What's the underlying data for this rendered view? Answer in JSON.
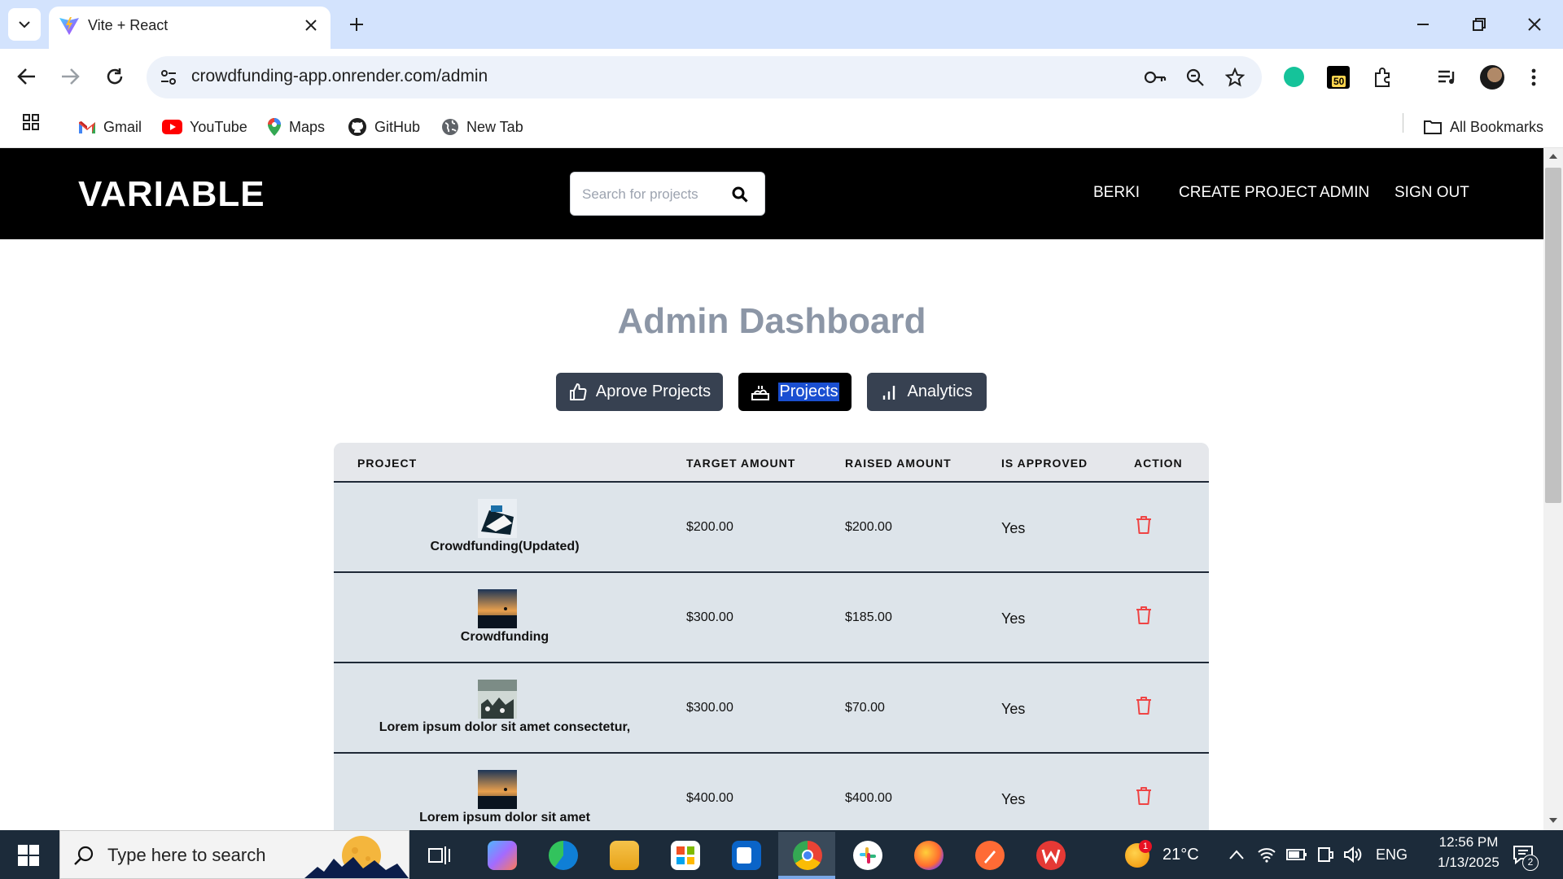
{
  "browser": {
    "tab_title": "Vite + React",
    "url": "crowdfunding-app.onrender.com/admin",
    "extension_badge": "50",
    "bookmarks": [
      "Gmail",
      "YouTube",
      "Maps",
      "GitHub",
      "New Tab"
    ],
    "all_bookmarks": "All Bookmarks"
  },
  "app": {
    "brand": "VARIABLE",
    "search_placeholder": "Search for projects",
    "nav": [
      "BERKI",
      "CREATE PROJECT",
      "ADMIN",
      "SIGN OUT"
    ]
  },
  "dashboard": {
    "title": "Admin Dashboard",
    "tabs": [
      "Aprove Projects",
      "Projects",
      "Analytics"
    ],
    "active_tab": "Projects"
  },
  "table": {
    "headers": [
      "PROJECT",
      "TARGET AMOUNT",
      "RAISED AMOUNT",
      "IS APPROVED",
      "ACTION"
    ],
    "rows": [
      {
        "name": "Crowdfunding(Updated)",
        "target": "$200.00",
        "raised": "$200.00",
        "approved": "Yes"
      },
      {
        "name": "Crowdfunding",
        "target": "$300.00",
        "raised": "$185.00",
        "approved": "Yes"
      },
      {
        "name": "Lorem ipsum dolor sit amet consectetur,",
        "target": "$300.00",
        "raised": "$70.00",
        "approved": "Yes"
      },
      {
        "name": "Lorem ipsum dolor sit amet",
        "target": "$400.00",
        "raised": "$400.00",
        "approved": "Yes"
      }
    ]
  },
  "taskbar": {
    "search_placeholder": "Type here to search",
    "weather_badge": "1",
    "temperature": "21°C",
    "language": "ENG",
    "time": "12:56 PM",
    "date": "1/13/2025",
    "notifications": "2"
  },
  "colors": {
    "navbar": "#000000",
    "tab_inactive": "#374151",
    "tab_active": "#000000",
    "delete_icon": "#ef4444",
    "title": "#8c96a6"
  }
}
